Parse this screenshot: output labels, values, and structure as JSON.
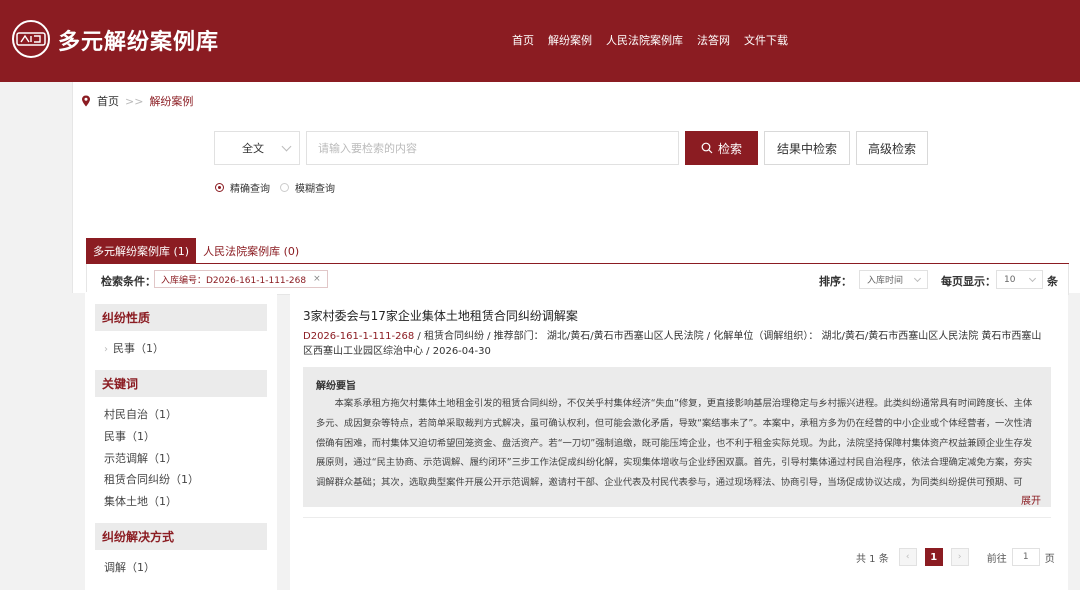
{
  "header": {
    "site_title": "多元解纷案例库",
    "nav": [
      "首页",
      "解纷案例",
      "人民法院案例库",
      "法答网",
      "文件下载"
    ]
  },
  "breadcrumb": {
    "home": "首页",
    "separator": ">>",
    "current": "解纷案例"
  },
  "search": {
    "scope_value": "全文",
    "placeholder": "请输入要检索的内容",
    "search_label": "检索",
    "within_label": "结果中检索",
    "advanced_label": "高级检索",
    "mode_exact": "精确查询",
    "mode_fuzzy": "模糊查询",
    "selected_mode": "精确查询"
  },
  "tabs": [
    {
      "label": "多元解纷案例库 (1)",
      "active": true
    },
    {
      "label": "人民法院案例库 (0)",
      "active": false
    }
  ],
  "conditions": {
    "label": "检索条件：",
    "chip": "入库编号：D2026-161-1-111-268",
    "chip_close": "×",
    "sort_label": "排序：",
    "sort_value": "入库时间",
    "per_page_label": "每页显示：",
    "per_page_value": "10",
    "per_page_unit": "条"
  },
  "facets": {
    "nature": {
      "title": "纠纷性质",
      "items": [
        "民事（1）"
      ]
    },
    "keywords": {
      "title": "关键词",
      "items": [
        "村民自治（1）",
        "民事（1）",
        "示范调解（1）",
        "租赁合同纠纷（1）",
        "集体土地（1）"
      ]
    },
    "method": {
      "title": "纠纷解决方式",
      "items": [
        "调解（1）"
      ]
    }
  },
  "result": {
    "title": "3家村委会与17家企业集体土地租赁合同纠纷调解案",
    "code": "D2026-161-1-111-268",
    "meta": " / 租赁合同纠纷 / 推荐部门： 湖北/黄石/黄石市西塞山区人民法院   / 化解单位（调解组织）： 湖北/黄石/黄石市西塞山区人民法院  黄石市西塞山区西塞山工业园区综治中心  / 2026-04-30",
    "summary_head": "解纷要旨",
    "summary": "本案系承租方拖欠村集体土地租金引发的租赁合同纠纷，不仅关乎村集体经济“失血”修复，更直接影响基层治理稳定与乡村振兴进程。此类纠纷通常具有时间跨度长、主体多元、成因复杂等特点，若简单采取裁判方式解决，虽可确认权利，但可能会激化矛盾，导致“案结事未了”。本案中，承租方多为仍在经营的中小企业或个体经营者，一次性清偿确有困难，而村集体又迫切希望回笼资金、盘活资产。若“一刀切”强制追缴，既可能压垮企业，也不利于租金实际兑现。为此，法院坚持保障村集体资产权益兼顾企业生存发展原则，通过“民主协商、示范调解、履约闭环”三步工作法促成纠纷化解，实现集体增收与企业纾困双赢。首先，引导村集体通过村民自治程序，依法合理确定减免方案，夯实调解群众基础；其次，选取典型案件开展公开示范调解，邀请村干部、企业代表及村民代表参与，通过现场释法、协商引导，当场促成协议达成，为同类纠纷提供可预期、可复...",
    "expand_label": "展开"
  },
  "pagination": {
    "total_text": "共 1 条",
    "prev": "‹",
    "current": "1",
    "next": "›",
    "goto_label": "前往",
    "goto_value": "1",
    "page_unit": "页"
  },
  "colors": {
    "brand": "#8b1c22",
    "panel_grey": "#ebebeb",
    "page_bg": "#f2f2f2"
  }
}
